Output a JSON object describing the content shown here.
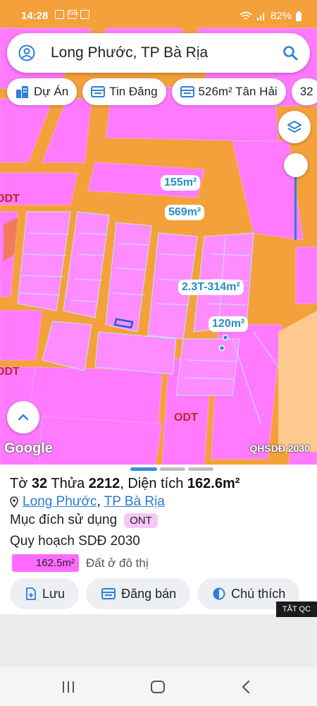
{
  "status_bar": {
    "time": "14:28",
    "battery": "82%",
    "app_icon": "Zalo"
  },
  "search": {
    "query": "Long Phước, TP Bà Rịa"
  },
  "chips": [
    {
      "label": "Dự Án",
      "icon": "building-icon"
    },
    {
      "label": "Tin Đăng",
      "icon": "list-icon"
    },
    {
      "label": "526m² Tân Hải",
      "icon": "list-icon"
    },
    {
      "label": "32",
      "icon": ""
    }
  ],
  "map": {
    "labels": {
      "a155": "155m²",
      "a569": "569m²",
      "a23t": "2.3T-314m²",
      "a120": "120m²"
    },
    "zone_labels": {
      "left_top": "ODT",
      "left_mid": "ODT",
      "center": "ODT"
    },
    "attribution": "Google",
    "overlay_name": "QHSDĐ 2030",
    "colors": {
      "residential": "#ff7aff",
      "road": "#f4a13b",
      "parcel_outline": "#bfe6f7"
    }
  },
  "panel": {
    "title_prefix": "Tờ",
    "sheet": "32",
    "parcel_word": "Thửa",
    "parcel": "2212",
    "area_word": ", Diện tích",
    "area": "162.6m²",
    "location_ward": "Long Phước",
    "location_city": "TP Bà Rịa",
    "location_sep": ",",
    "purpose_label": "Mục đích sử dụng",
    "purpose_code": "ONT",
    "plan_label": "Quy hoạch SDĐ 2030",
    "legend_area": "162.5m²",
    "legend_desc": "Đất ở đô thị",
    "actions": [
      "Lưu",
      "Đăng bán",
      "Chú thích"
    ],
    "page_indicator": {
      "count": 3,
      "active": 1
    }
  },
  "ad_label": "TẮT QC"
}
